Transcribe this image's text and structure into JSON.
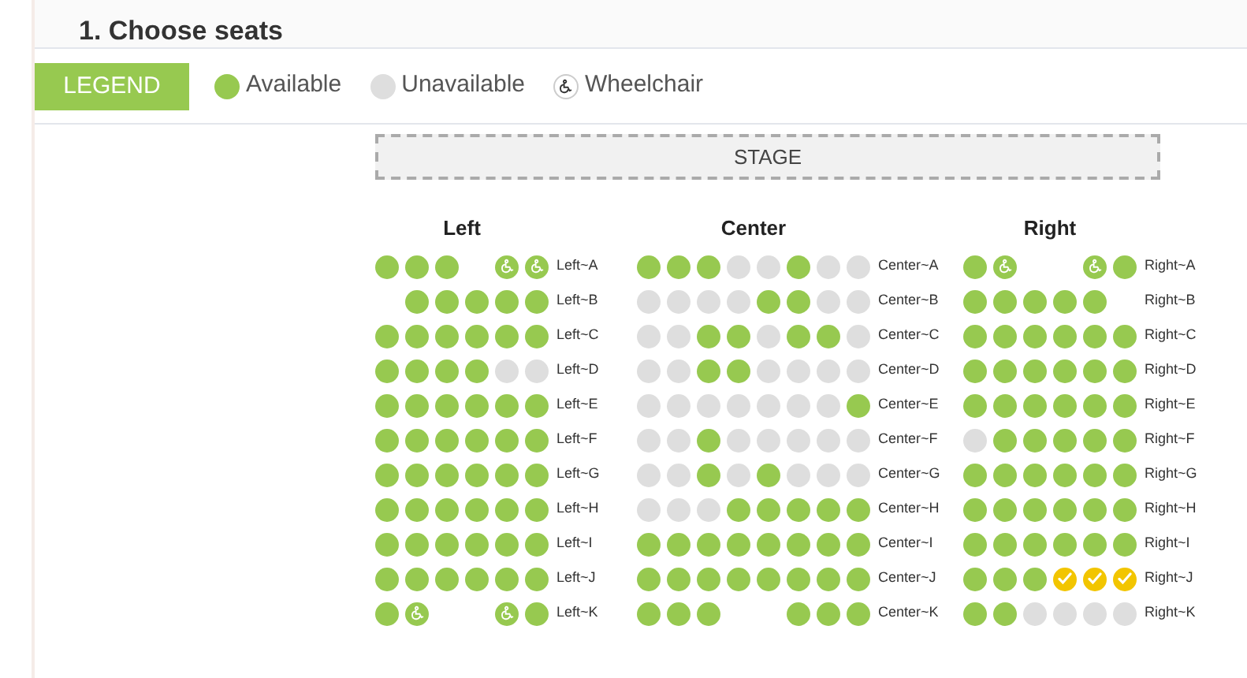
{
  "page_title": "1. Choose seats",
  "legend": {
    "button": "LEGEND",
    "items": [
      {
        "kind": "available",
        "label": "Available"
      },
      {
        "kind": "unavailable",
        "label": "Unavailable"
      },
      {
        "kind": "wheelchair",
        "label": "Wheelchair"
      }
    ]
  },
  "stage": "STAGE",
  "sections": [
    {
      "title": "Left",
      "rows": [
        {
          "label": "Left~A",
          "seats": [
            {
              "kind": "available"
            },
            {
              "kind": "available"
            },
            {
              "kind": "available"
            },
            {
              "kind": "gap"
            },
            {
              "kind": "wheelchair"
            },
            {
              "kind": "wheelchair"
            }
          ]
        },
        {
          "label": "Left~B",
          "seats": [
            {
              "kind": "gap"
            },
            {
              "kind": "available"
            },
            {
              "kind": "available"
            },
            {
              "kind": "available"
            },
            {
              "kind": "available"
            },
            {
              "kind": "available"
            }
          ]
        },
        {
          "label": "Left~C",
          "seats": [
            {
              "kind": "available"
            },
            {
              "kind": "available"
            },
            {
              "kind": "available"
            },
            {
              "kind": "available"
            },
            {
              "kind": "available"
            },
            {
              "kind": "available"
            }
          ]
        },
        {
          "label": "Left~D",
          "seats": [
            {
              "kind": "available"
            },
            {
              "kind": "available"
            },
            {
              "kind": "available"
            },
            {
              "kind": "available"
            },
            {
              "kind": "unavailable"
            },
            {
              "kind": "unavailable"
            }
          ]
        },
        {
          "label": "Left~E",
          "seats": [
            {
              "kind": "available"
            },
            {
              "kind": "available"
            },
            {
              "kind": "available"
            },
            {
              "kind": "available"
            },
            {
              "kind": "available"
            },
            {
              "kind": "available"
            }
          ]
        },
        {
          "label": "Left~F",
          "seats": [
            {
              "kind": "available"
            },
            {
              "kind": "available"
            },
            {
              "kind": "available"
            },
            {
              "kind": "available"
            },
            {
              "kind": "available"
            },
            {
              "kind": "available"
            }
          ]
        },
        {
          "label": "Left~G",
          "seats": [
            {
              "kind": "available"
            },
            {
              "kind": "available"
            },
            {
              "kind": "available"
            },
            {
              "kind": "available"
            },
            {
              "kind": "available"
            },
            {
              "kind": "available"
            }
          ]
        },
        {
          "label": "Left~H",
          "seats": [
            {
              "kind": "available"
            },
            {
              "kind": "available"
            },
            {
              "kind": "available"
            },
            {
              "kind": "available"
            },
            {
              "kind": "available"
            },
            {
              "kind": "available"
            }
          ]
        },
        {
          "label": "Left~I",
          "seats": [
            {
              "kind": "available"
            },
            {
              "kind": "available"
            },
            {
              "kind": "available"
            },
            {
              "kind": "available"
            },
            {
              "kind": "available"
            },
            {
              "kind": "available"
            }
          ]
        },
        {
          "label": "Left~J",
          "seats": [
            {
              "kind": "available"
            },
            {
              "kind": "available"
            },
            {
              "kind": "available"
            },
            {
              "kind": "available"
            },
            {
              "kind": "available"
            },
            {
              "kind": "available"
            }
          ]
        },
        {
          "label": "Left~K",
          "seats": [
            {
              "kind": "available"
            },
            {
              "kind": "wheelchair"
            },
            {
              "kind": "gap"
            },
            {
              "kind": "gap"
            },
            {
              "kind": "wheelchair"
            },
            {
              "kind": "available"
            }
          ]
        }
      ]
    },
    {
      "title": "Center",
      "rows": [
        {
          "label": "Center~A",
          "seats": [
            {
              "kind": "available"
            },
            {
              "kind": "available"
            },
            {
              "kind": "available"
            },
            {
              "kind": "unavailable"
            },
            {
              "kind": "unavailable"
            },
            {
              "kind": "available"
            },
            {
              "kind": "unavailable"
            },
            {
              "kind": "unavailable"
            }
          ]
        },
        {
          "label": "Center~B",
          "seats": [
            {
              "kind": "unavailable"
            },
            {
              "kind": "unavailable"
            },
            {
              "kind": "unavailable"
            },
            {
              "kind": "unavailable"
            },
            {
              "kind": "available"
            },
            {
              "kind": "available"
            },
            {
              "kind": "unavailable"
            },
            {
              "kind": "unavailable"
            }
          ]
        },
        {
          "label": "Center~C",
          "seats": [
            {
              "kind": "unavailable"
            },
            {
              "kind": "unavailable"
            },
            {
              "kind": "available"
            },
            {
              "kind": "available"
            },
            {
              "kind": "unavailable"
            },
            {
              "kind": "available"
            },
            {
              "kind": "available"
            },
            {
              "kind": "unavailable"
            }
          ]
        },
        {
          "label": "Center~D",
          "seats": [
            {
              "kind": "unavailable"
            },
            {
              "kind": "unavailable"
            },
            {
              "kind": "available"
            },
            {
              "kind": "available"
            },
            {
              "kind": "unavailable"
            },
            {
              "kind": "unavailable"
            },
            {
              "kind": "unavailable"
            },
            {
              "kind": "unavailable"
            }
          ]
        },
        {
          "label": "Center~E",
          "seats": [
            {
              "kind": "unavailable"
            },
            {
              "kind": "unavailable"
            },
            {
              "kind": "unavailable"
            },
            {
              "kind": "unavailable"
            },
            {
              "kind": "unavailable"
            },
            {
              "kind": "unavailable"
            },
            {
              "kind": "unavailable"
            },
            {
              "kind": "available"
            }
          ]
        },
        {
          "label": "Center~F",
          "seats": [
            {
              "kind": "unavailable"
            },
            {
              "kind": "unavailable"
            },
            {
              "kind": "available"
            },
            {
              "kind": "unavailable"
            },
            {
              "kind": "unavailable"
            },
            {
              "kind": "unavailable"
            },
            {
              "kind": "unavailable"
            },
            {
              "kind": "unavailable"
            }
          ]
        },
        {
          "label": "Center~G",
          "seats": [
            {
              "kind": "unavailable"
            },
            {
              "kind": "unavailable"
            },
            {
              "kind": "available"
            },
            {
              "kind": "unavailable"
            },
            {
              "kind": "available"
            },
            {
              "kind": "unavailable"
            },
            {
              "kind": "unavailable"
            },
            {
              "kind": "unavailable"
            }
          ]
        },
        {
          "label": "Center~H",
          "seats": [
            {
              "kind": "unavailable"
            },
            {
              "kind": "unavailable"
            },
            {
              "kind": "unavailable"
            },
            {
              "kind": "available"
            },
            {
              "kind": "available"
            },
            {
              "kind": "available"
            },
            {
              "kind": "available"
            },
            {
              "kind": "available"
            }
          ]
        },
        {
          "label": "Center~I",
          "seats": [
            {
              "kind": "available"
            },
            {
              "kind": "available"
            },
            {
              "kind": "available"
            },
            {
              "kind": "available"
            },
            {
              "kind": "available"
            },
            {
              "kind": "available"
            },
            {
              "kind": "available"
            },
            {
              "kind": "available"
            }
          ]
        },
        {
          "label": "Center~J",
          "seats": [
            {
              "kind": "available"
            },
            {
              "kind": "available"
            },
            {
              "kind": "available"
            },
            {
              "kind": "available"
            },
            {
              "kind": "available"
            },
            {
              "kind": "available"
            },
            {
              "kind": "available"
            },
            {
              "kind": "available"
            }
          ]
        },
        {
          "label": "Center~K",
          "seats": [
            {
              "kind": "available"
            },
            {
              "kind": "available"
            },
            {
              "kind": "available"
            },
            {
              "kind": "gap"
            },
            {
              "kind": "gap"
            },
            {
              "kind": "available"
            },
            {
              "kind": "available"
            },
            {
              "kind": "available"
            }
          ]
        }
      ]
    },
    {
      "title": "Right",
      "rows": [
        {
          "label": "Right~A",
          "seats": [
            {
              "kind": "available"
            },
            {
              "kind": "wheelchair"
            },
            {
              "kind": "gap"
            },
            {
              "kind": "gap"
            },
            {
              "kind": "wheelchair"
            },
            {
              "kind": "available"
            }
          ]
        },
        {
          "label": "Right~B",
          "seats": [
            {
              "kind": "available"
            },
            {
              "kind": "available"
            },
            {
              "kind": "available"
            },
            {
              "kind": "available"
            },
            {
              "kind": "available"
            },
            {
              "kind": "gap"
            }
          ]
        },
        {
          "label": "Right~C",
          "seats": [
            {
              "kind": "available"
            },
            {
              "kind": "available"
            },
            {
              "kind": "available"
            },
            {
              "kind": "available"
            },
            {
              "kind": "available"
            },
            {
              "kind": "available"
            }
          ]
        },
        {
          "label": "Right~D",
          "seats": [
            {
              "kind": "available"
            },
            {
              "kind": "available"
            },
            {
              "kind": "available"
            },
            {
              "kind": "available"
            },
            {
              "kind": "available"
            },
            {
              "kind": "available"
            }
          ]
        },
        {
          "label": "Right~E",
          "seats": [
            {
              "kind": "available"
            },
            {
              "kind": "available"
            },
            {
              "kind": "available"
            },
            {
              "kind": "available"
            },
            {
              "kind": "available"
            },
            {
              "kind": "available"
            }
          ]
        },
        {
          "label": "Right~F",
          "seats": [
            {
              "kind": "unavailable"
            },
            {
              "kind": "available"
            },
            {
              "kind": "available"
            },
            {
              "kind": "available"
            },
            {
              "kind": "available"
            },
            {
              "kind": "available"
            }
          ]
        },
        {
          "label": "Right~G",
          "seats": [
            {
              "kind": "available"
            },
            {
              "kind": "available"
            },
            {
              "kind": "available"
            },
            {
              "kind": "available"
            },
            {
              "kind": "available"
            },
            {
              "kind": "available"
            }
          ]
        },
        {
          "label": "Right~H",
          "seats": [
            {
              "kind": "available"
            },
            {
              "kind": "available"
            },
            {
              "kind": "available"
            },
            {
              "kind": "available"
            },
            {
              "kind": "available"
            },
            {
              "kind": "available"
            }
          ]
        },
        {
          "label": "Right~I",
          "seats": [
            {
              "kind": "available"
            },
            {
              "kind": "available"
            },
            {
              "kind": "available"
            },
            {
              "kind": "available"
            },
            {
              "kind": "available"
            },
            {
              "kind": "available"
            }
          ]
        },
        {
          "label": "Right~J",
          "seats": [
            {
              "kind": "available"
            },
            {
              "kind": "available"
            },
            {
              "kind": "available"
            },
            {
              "kind": "selected"
            },
            {
              "kind": "selected"
            },
            {
              "kind": "selected"
            }
          ]
        },
        {
          "label": "Right~K",
          "seats": [
            {
              "kind": "available"
            },
            {
              "kind": "available"
            },
            {
              "kind": "unavailable"
            },
            {
              "kind": "unavailable"
            },
            {
              "kind": "unavailable"
            },
            {
              "kind": "unavailable"
            }
          ]
        }
      ]
    }
  ]
}
